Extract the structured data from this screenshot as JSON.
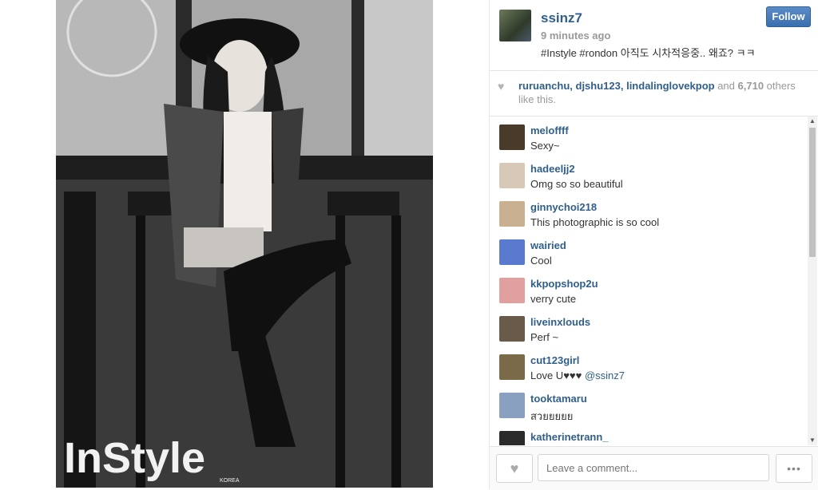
{
  "post": {
    "username": "ssinz7",
    "time_ago": "9 minutes ago",
    "caption": "#Instyle #rondon 아직도 시차적응중.. 왜죠? ㅋㅋ",
    "follow_label": "Follow",
    "photo_brand": "InStyle",
    "photo_brand_sub": "KOREA"
  },
  "likes": {
    "names": "ruruanchu, djshu123, lindalinglovekpop",
    "and": " and ",
    "count": "6,710",
    "suffix": " others like this."
  },
  "comments": [
    {
      "user": "meloffff",
      "text": "Sexy~",
      "avatar_color": "#4a3a2a"
    },
    {
      "user": "hadeeljj2",
      "text": "Omg so so beautiful ",
      "avatar_color": "#d8c8b8"
    },
    {
      "user": "ginnychoi218",
      "text": "This photographic is so cool ",
      "avatar_color": "#c8b090"
    },
    {
      "user": "wairied",
      "text": "Cool ",
      "avatar_color": "#5a7ad0"
    },
    {
      "user": "kkpopshop2u",
      "text": "verry cute ",
      "avatar_color": "#e0a0a0"
    },
    {
      "user": "liveinxlouds",
      "text": "Perf ~",
      "avatar_color": "#6a5a4a"
    },
    {
      "user": "cut123girl",
      "text": "Love U♥♥♥ ",
      "mention": "@ssinz7",
      "avatar_color": "#7a6a4a"
    },
    {
      "user": "tooktamaru",
      "text": "สวยยยยย",
      "avatar_color": "#8aa0c0"
    },
    {
      "user": "katherinetrann_",
      "text": "",
      "avatar_color": "#2a2a2a"
    }
  ],
  "footer": {
    "placeholder": "Leave a comment...",
    "more": "•••"
  },
  "icons": {
    "heart": "♥",
    "scroll_up": "▲",
    "scroll_down": "▼"
  }
}
